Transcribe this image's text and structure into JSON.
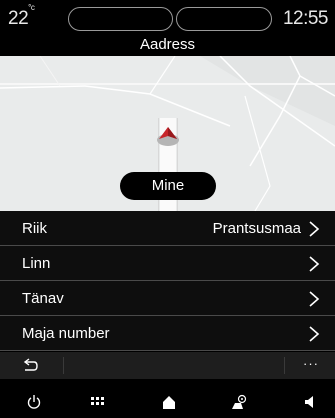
{
  "status": {
    "temperature": "22",
    "temperature_unit": "°c",
    "clock": "12:55"
  },
  "screen": {
    "title": "Aadress"
  },
  "map": {
    "go_label": "Mine",
    "location_marker_icon": "position-arrow-icon"
  },
  "address_fields": [
    {
      "label": "Riik",
      "value": "Prantsusmaa",
      "icon": "chevron-right-icon"
    },
    {
      "label": "Linn",
      "value": "",
      "icon": "chevron-right-icon"
    },
    {
      "label": "Tänav",
      "value": "",
      "icon": "chevron-right-icon"
    },
    {
      "label": "Maja number",
      "value": "",
      "icon": "chevron-right-icon"
    }
  ],
  "toolbar": {
    "back_icon": "back-arrow-icon",
    "more_label": "···"
  },
  "navbar": {
    "items": [
      "power-icon",
      "apps-grid-icon",
      "home-icon",
      "driving-assist-icon",
      "volume-icon"
    ]
  },
  "colors": {
    "background": "#000000",
    "list_row": "#0e0e0e",
    "toolbar": "#1e1e1e",
    "marker": "#c8262b"
  }
}
